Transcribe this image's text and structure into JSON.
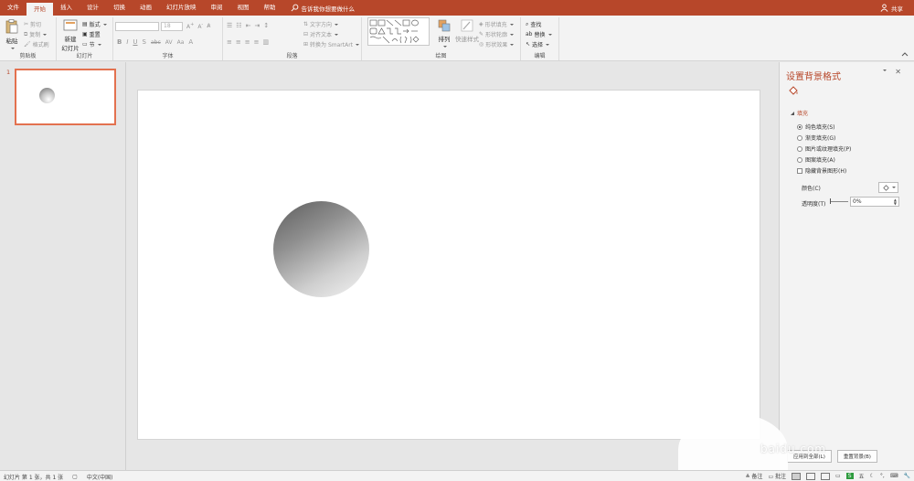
{
  "tabs": [
    "文件",
    "开始",
    "插入",
    "设计",
    "切换",
    "动画",
    "幻灯片放映",
    "审阅",
    "视图",
    "帮助"
  ],
  "active_tab": "开始",
  "tell_me": "告诉我你想要做什么",
  "share": "共享",
  "ribbon": {
    "clipboard": {
      "label": "剪贴板",
      "paste": "粘贴",
      "cut": "剪切",
      "copy": "复制",
      "format_painter": "格式刷"
    },
    "slides": {
      "label": "幻灯片",
      "new_slide_line1": "新建",
      "new_slide_line2": "幻灯片",
      "layout": "版式",
      "reset": "重置",
      "section": "节"
    },
    "font": {
      "label": "字体",
      "font_name": "",
      "font_size": "18",
      "bold": "B",
      "italic": "I",
      "underline": "U",
      "strike": "S",
      "shadow": "abc",
      "spacing": "AV",
      "case": "Aa",
      "color": "A"
    },
    "paragraph": {
      "label": "段落",
      "text_direction": "文字方向",
      "align_text": "对齐文本",
      "convert_smartart": "转换为 SmartArt"
    },
    "drawing": {
      "label": "绘图",
      "arrange": "排列",
      "quick_styles": "快速样式",
      "shape_fill": "形状填充",
      "shape_outline": "形状轮廓",
      "shape_effects": "形状效果"
    },
    "editing": {
      "label": "编辑",
      "find": "查找",
      "replace": "替换",
      "select": "选择"
    }
  },
  "thumbnail": {
    "number": "1"
  },
  "pane": {
    "title": "设置背景格式",
    "section": "填充",
    "options": [
      {
        "label": "纯色填充(S)",
        "type": "radio",
        "checked": true
      },
      {
        "label": "渐变填充(G)",
        "type": "radio",
        "checked": false
      },
      {
        "label": "图片或纹理填充(P)",
        "type": "radio",
        "checked": false
      },
      {
        "label": "图案填充(A)",
        "type": "radio",
        "checked": false
      },
      {
        "label": "隐藏背景图形(H)",
        "type": "checkbox",
        "checked": false
      }
    ],
    "color_label": "颜色(C)",
    "transparency_label": "透明度(T)",
    "transparency_value": "0%",
    "apply_all": "应用到全部(L)",
    "reset_bg": "重置背景(B)"
  },
  "status": {
    "slide_info": "幻灯片 第 1 张，共 1 张",
    "language": "中文(中国)",
    "notes": "备注",
    "comments": "批注"
  },
  "watermark": "baidu.com",
  "colors": {
    "accent": "#b7472a",
    "thumb_border": "#e3714f"
  }
}
